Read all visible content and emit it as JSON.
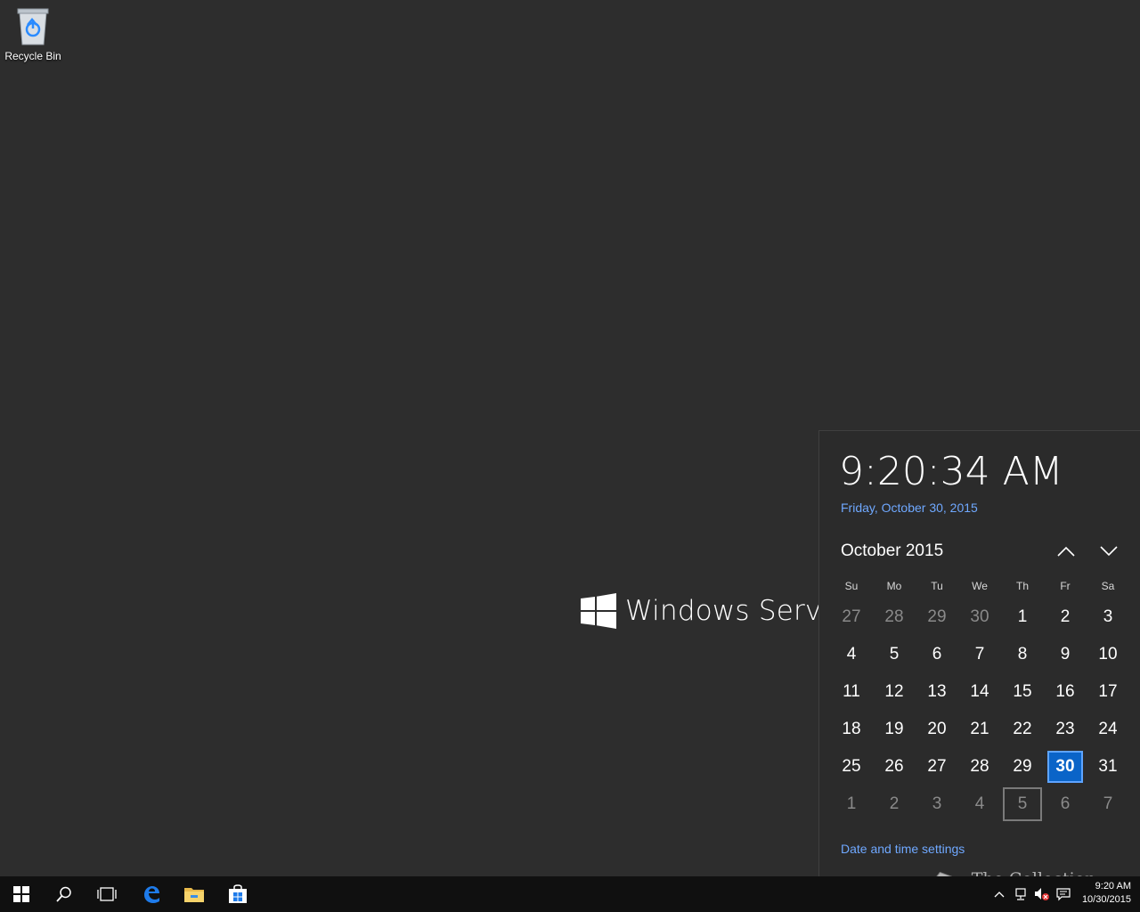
{
  "desktop": {
    "recycle_bin_label": "Recycle Bin",
    "logo_text": "Windows Server"
  },
  "flyout": {
    "time": "9:20:34 AM",
    "date_long": "Friday, October 30, 2015",
    "month_label": "October 2015",
    "dow": [
      "Su",
      "Mo",
      "Tu",
      "We",
      "Th",
      "Fr",
      "Sa"
    ],
    "weeks": [
      [
        {
          "d": "27",
          "m": 1
        },
        {
          "d": "28",
          "m": 1
        },
        {
          "d": "29",
          "m": 1
        },
        {
          "d": "30",
          "m": 1
        },
        {
          "d": "1"
        },
        {
          "d": "2"
        },
        {
          "d": "3"
        }
      ],
      [
        {
          "d": "4"
        },
        {
          "d": "5"
        },
        {
          "d": "6"
        },
        {
          "d": "7"
        },
        {
          "d": "8"
        },
        {
          "d": "9"
        },
        {
          "d": "10"
        }
      ],
      [
        {
          "d": "11"
        },
        {
          "d": "12"
        },
        {
          "d": "13"
        },
        {
          "d": "14"
        },
        {
          "d": "15"
        },
        {
          "d": "16"
        },
        {
          "d": "17"
        }
      ],
      [
        {
          "d": "18"
        },
        {
          "d": "19"
        },
        {
          "d": "20"
        },
        {
          "d": "21"
        },
        {
          "d": "22"
        },
        {
          "d": "23"
        },
        {
          "d": "24"
        }
      ],
      [
        {
          "d": "25"
        },
        {
          "d": "26"
        },
        {
          "d": "27"
        },
        {
          "d": "28"
        },
        {
          "d": "29"
        },
        {
          "d": "30",
          "today": 1
        },
        {
          "d": "31"
        }
      ],
      [
        {
          "d": "1",
          "m": 1
        },
        {
          "d": "2",
          "m": 1
        },
        {
          "d": "3",
          "m": 1
        },
        {
          "d": "4",
          "m": 1
        },
        {
          "d": "5",
          "m": 1,
          "outlined": 1
        },
        {
          "d": "6",
          "m": 1
        },
        {
          "d": "7",
          "m": 1
        }
      ]
    ],
    "settings_link": "Date and time settings",
    "accent_color": "#0a64c8",
    "link_color": "#6fa8ff"
  },
  "taskbar": {
    "buttons": [
      "start-icon",
      "search-icon",
      "task-view-icon",
      "edge-icon",
      "file-explorer-icon",
      "store-icon"
    ],
    "tray_time": "9:20 AM",
    "tray_date": "10/30/2015",
    "watermark_text": "The Collection Book"
  }
}
